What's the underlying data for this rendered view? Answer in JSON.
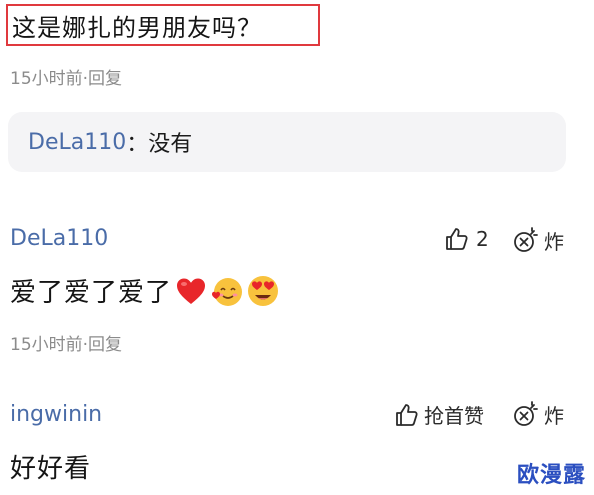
{
  "top_comment": {
    "text": "这是娜扎的男朋友吗？",
    "meta": "15小时前·回复"
  },
  "reply_preview": {
    "name": "DeLa110",
    "separator": "：",
    "text": "没有"
  },
  "comments": [
    {
      "username": "DeLa110",
      "like_count": "2",
      "boom_label": "炸",
      "text": "爱了爱了爱了",
      "emojis": [
        "red-heart-icon",
        "smiling-face-with-hearts-icon",
        "heart-eyes-icon"
      ],
      "meta": "15小时前·回复"
    },
    {
      "username": "ingwinin",
      "like_label": "抢首赞",
      "boom_label": "炸",
      "text": "好好看"
    }
  ],
  "watermark": "欧漫露",
  "colors": {
    "username": "#4a6ca8",
    "highlight_border": "#e0393e",
    "meta": "#8b8b8b",
    "reply_bg": "#f4f4f6",
    "watermark": "#2b4fc0"
  }
}
